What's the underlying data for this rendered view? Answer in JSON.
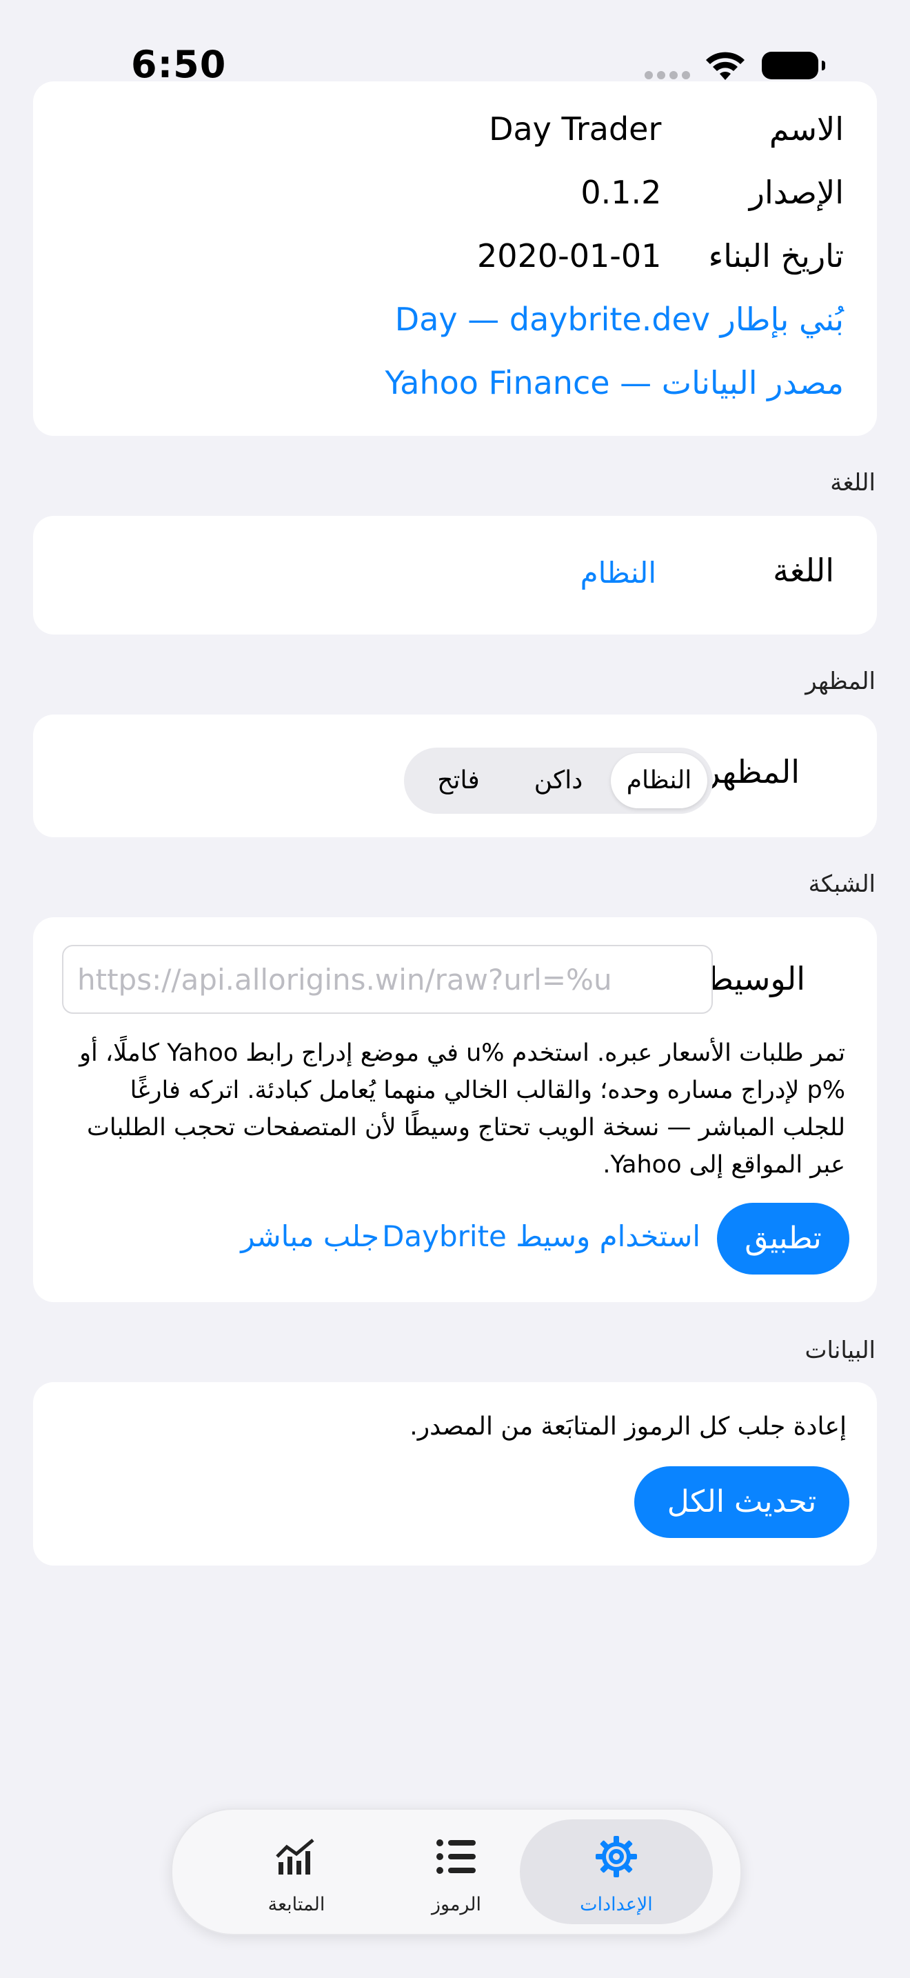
{
  "status_bar": {
    "time": "6:50"
  },
  "about": {
    "rows": [
      {
        "label": "الاسم",
        "value": "Day Trader"
      },
      {
        "label": "الإصدار",
        "value": "0.1.2"
      },
      {
        "label": "تاريخ البناء",
        "value": "2020-01-01"
      }
    ],
    "built_with": "بُني بإطار Day — daybrite.dev",
    "data_source": "مصدر البيانات — Yahoo Finance"
  },
  "language": {
    "section_title": "اللغة",
    "row_label": "اللغة",
    "value": "النظام"
  },
  "appearance": {
    "section_title": "المظهر",
    "row_label": "المظهر",
    "options": [
      "النظام",
      "داكن",
      "فاتح"
    ],
    "selected": "النظام"
  },
  "network": {
    "section_title": "الشبكة",
    "row_label": "الوسيط",
    "proxy_value": "",
    "proxy_placeholder": "https://api.allorigins.win/raw?url=%u",
    "help_text": "تمر طلبات الأسعار عبره. استخدم %u في موضع إدراج رابط Yahoo كاملًا، أو %p لإدراج مساره وحده؛ والقالب الخالي منهما يُعامل كبادئة. اتركه فارغًا للجلب المباشر — نسخة الويب تحتاج وسيطًا لأن المتصفحات تحجب الطلبات عبر المواقع إلى Yahoo.",
    "apply_label": "تطبيق",
    "use_daybrite_label": "استخدام وسيط Daybrite",
    "direct_fetch_label": "جلب مباشر"
  },
  "data": {
    "section_title": "البيانات",
    "description": "إعادة جلب كل الرموز المتابَعة من المصدر.",
    "refresh_all_label": "تحديث الكل"
  },
  "tab_bar": {
    "tabs": [
      {
        "label": "المتابعة",
        "icon": "chart-icon",
        "active": false
      },
      {
        "label": "الرموز",
        "icon": "list-icon",
        "active": false
      },
      {
        "label": "الإعدادات",
        "icon": "gear-icon",
        "active": true
      }
    ]
  },
  "colors": {
    "accent": "#0a84ff",
    "background": "#f2f2f7",
    "card": "#ffffff"
  }
}
